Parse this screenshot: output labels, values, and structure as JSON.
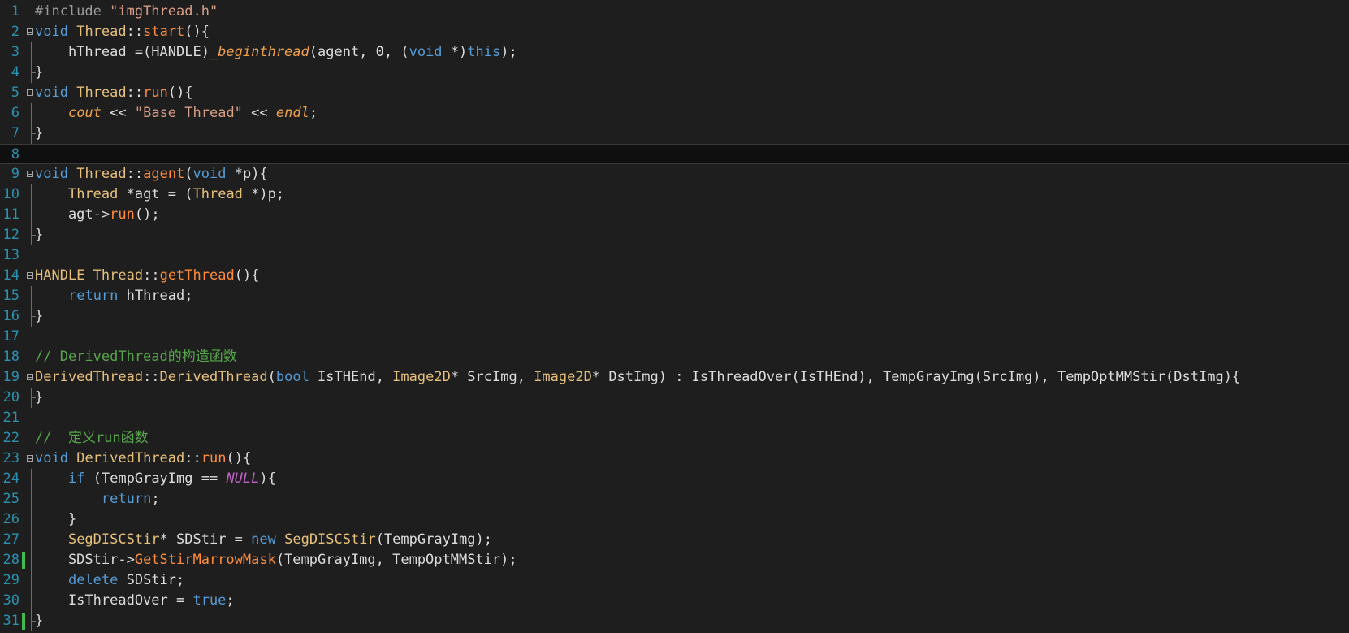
{
  "editor": {
    "colors": {
      "background": "#1e1e1e",
      "line_number": "#2b91af",
      "keyword": "#569cd6",
      "type": "#e6c07b",
      "function": "#ff8c3a",
      "string": "#d69d85",
      "comment": "#57a64a",
      "changed_marker": "#3fb950"
    },
    "lines": [
      {
        "n": "1",
        "fold": false,
        "guide": "none",
        "tokens": [
          [
            "pp",
            "#include "
          ],
          [
            "st",
            "\"imgThread.h\""
          ]
        ]
      },
      {
        "n": "2",
        "fold": true,
        "guide": "none",
        "tokens": [
          [
            "kw",
            "void"
          ],
          [
            "pl",
            " "
          ],
          [
            "ty",
            "Thread"
          ],
          [
            "pl",
            "::"
          ],
          [
            "fn",
            "start"
          ],
          [
            "pl",
            "(){"
          ]
        ]
      },
      {
        "n": "3",
        "fold": false,
        "guide": "mid",
        "tokens": [
          [
            "pl",
            "    hThread =(HANDLE)"
          ],
          [
            "it",
            "_beginthread"
          ],
          [
            "pl",
            "(agent, 0, ("
          ],
          [
            "kw",
            "void"
          ],
          [
            "pl",
            " *)"
          ],
          [
            "kw",
            "this"
          ],
          [
            "pl",
            ");"
          ]
        ]
      },
      {
        "n": "4",
        "fold": false,
        "guide": "end",
        "tokens": [
          [
            "pl",
            "}"
          ]
        ]
      },
      {
        "n": "5",
        "fold": true,
        "guide": "none",
        "tokens": [
          [
            "kw",
            "void"
          ],
          [
            "pl",
            " "
          ],
          [
            "ty",
            "Thread"
          ],
          [
            "pl",
            "::"
          ],
          [
            "fn",
            "run"
          ],
          [
            "pl",
            "(){"
          ]
        ]
      },
      {
        "n": "6",
        "fold": false,
        "guide": "mid",
        "tokens": [
          [
            "pl",
            "    "
          ],
          [
            "it",
            "cout"
          ],
          [
            "pl",
            " << "
          ],
          [
            "st",
            "\"Base Thread\""
          ],
          [
            "pl",
            " << "
          ],
          [
            "it",
            "endl"
          ],
          [
            "pl",
            ";"
          ]
        ]
      },
      {
        "n": "7",
        "fold": false,
        "guide": "end",
        "tokens": [
          [
            "pl",
            "}"
          ]
        ]
      },
      {
        "n": "8",
        "fold": false,
        "guide": "none",
        "current": true,
        "tokens": []
      },
      {
        "n": "9",
        "fold": true,
        "guide": "none",
        "tokens": [
          [
            "kw",
            "void"
          ],
          [
            "pl",
            " "
          ],
          [
            "ty",
            "Thread"
          ],
          [
            "pl",
            "::"
          ],
          [
            "fn",
            "agent"
          ],
          [
            "pl",
            "("
          ],
          [
            "kw",
            "void"
          ],
          [
            "pl",
            " *p){"
          ]
        ]
      },
      {
        "n": "10",
        "fold": false,
        "guide": "mid",
        "tokens": [
          [
            "pl",
            "    "
          ],
          [
            "ty",
            "Thread"
          ],
          [
            "pl",
            " *agt = ("
          ],
          [
            "ty",
            "Thread"
          ],
          [
            "pl",
            " *)p;"
          ]
        ]
      },
      {
        "n": "11",
        "fold": false,
        "guide": "mid",
        "tokens": [
          [
            "pl",
            "    agt->"
          ],
          [
            "fn",
            "run"
          ],
          [
            "pl",
            "();"
          ]
        ]
      },
      {
        "n": "12",
        "fold": false,
        "guide": "end",
        "tokens": [
          [
            "pl",
            "}"
          ]
        ]
      },
      {
        "n": "13",
        "fold": false,
        "guide": "none",
        "tokens": []
      },
      {
        "n": "14",
        "fold": true,
        "guide": "none",
        "tokens": [
          [
            "ty",
            "HANDLE"
          ],
          [
            "pl",
            " "
          ],
          [
            "ty",
            "Thread"
          ],
          [
            "pl",
            "::"
          ],
          [
            "fn",
            "getThread"
          ],
          [
            "pl",
            "(){"
          ]
        ]
      },
      {
        "n": "15",
        "fold": false,
        "guide": "mid",
        "tokens": [
          [
            "pl",
            "    "
          ],
          [
            "kw",
            "return"
          ],
          [
            "pl",
            " hThread;"
          ]
        ]
      },
      {
        "n": "16",
        "fold": false,
        "guide": "end",
        "tokens": [
          [
            "pl",
            "}"
          ]
        ]
      },
      {
        "n": "17",
        "fold": false,
        "guide": "none",
        "tokens": []
      },
      {
        "n": "18",
        "fold": false,
        "guide": "none",
        "tokens": [
          [
            "cm",
            "// DerivedThread的构造函数"
          ]
        ]
      },
      {
        "n": "19",
        "fold": true,
        "guide": "none",
        "tokens": [
          [
            "ty",
            "DerivedThread"
          ],
          [
            "pl",
            "::"
          ],
          [
            "ty",
            "DerivedThread"
          ],
          [
            "pl",
            "("
          ],
          [
            "kw",
            "bool"
          ],
          [
            "pl",
            " IsTHEnd, "
          ],
          [
            "ty",
            "Image2D"
          ],
          [
            "pl",
            "* SrcImg, "
          ],
          [
            "ty",
            "Image2D"
          ],
          [
            "pl",
            "* DstImg) : IsThreadOver(IsTHEnd), TempGrayImg(SrcImg), TempOptMMStir(DstImg){"
          ]
        ]
      },
      {
        "n": "20",
        "fold": false,
        "guide": "end",
        "tokens": [
          [
            "pl",
            "}"
          ]
        ]
      },
      {
        "n": "21",
        "fold": false,
        "guide": "none",
        "tokens": []
      },
      {
        "n": "22",
        "fold": false,
        "guide": "none",
        "tokens": [
          [
            "cm",
            "//  定义run函数"
          ]
        ]
      },
      {
        "n": "23",
        "fold": true,
        "guide": "none",
        "tokens": [
          [
            "kw",
            "void"
          ],
          [
            "pl",
            " "
          ],
          [
            "ty",
            "DerivedThread"
          ],
          [
            "pl",
            "::"
          ],
          [
            "fn",
            "run"
          ],
          [
            "pl",
            "(){"
          ]
        ]
      },
      {
        "n": "24",
        "fold": false,
        "guide": "mid",
        "tokens": [
          [
            "pl",
            "    "
          ],
          [
            "kw",
            "if"
          ],
          [
            "pl",
            " (TempGrayImg == "
          ],
          [
            "mc",
            "NULL"
          ],
          [
            "pl",
            "){"
          ]
        ]
      },
      {
        "n": "25",
        "fold": false,
        "guide": "mid",
        "tokens": [
          [
            "pl",
            "        "
          ],
          [
            "kw",
            "return"
          ],
          [
            "pl",
            ";"
          ]
        ]
      },
      {
        "n": "26",
        "fold": false,
        "guide": "mid",
        "tokens": [
          [
            "pl",
            "    }"
          ]
        ]
      },
      {
        "n": "27",
        "fold": false,
        "guide": "mid",
        "tokens": [
          [
            "pl",
            "    "
          ],
          [
            "ty",
            "SegDISCStir"
          ],
          [
            "pl",
            "* SDStir = "
          ],
          [
            "kw",
            "new"
          ],
          [
            "pl",
            " "
          ],
          [
            "ty",
            "SegDISCStir"
          ],
          [
            "pl",
            "(TempGrayImg);"
          ]
        ]
      },
      {
        "n": "28",
        "fold": false,
        "guide": "mid",
        "changed": true,
        "tokens": [
          [
            "pl",
            "    SDStir->"
          ],
          [
            "fn",
            "GetStirMarrowMask"
          ],
          [
            "pl",
            "(TempGrayImg, TempOptMMStir);"
          ]
        ]
      },
      {
        "n": "29",
        "fold": false,
        "guide": "mid",
        "tokens": [
          [
            "pl",
            "    "
          ],
          [
            "kw",
            "delete"
          ],
          [
            "pl",
            " SDStir;"
          ]
        ]
      },
      {
        "n": "30",
        "fold": false,
        "guide": "mid",
        "tokens": [
          [
            "pl",
            "    IsThreadOver = "
          ],
          [
            "kw",
            "true"
          ],
          [
            "pl",
            ";"
          ]
        ]
      },
      {
        "n": "31",
        "fold": false,
        "guide": "end",
        "changed": true,
        "tokens": [
          [
            "pl",
            "}"
          ]
        ]
      }
    ]
  }
}
